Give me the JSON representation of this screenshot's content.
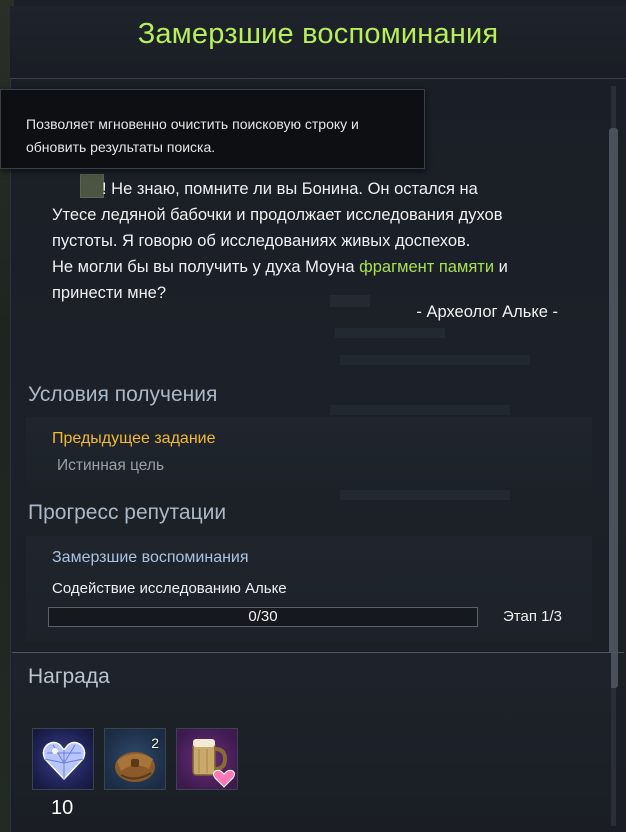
{
  "window": {
    "title": "Замерзшие воспоминания"
  },
  "tooltip": {
    "text": "Позволяет мгновенно очистить поисковую строку и обновить результаты поиска."
  },
  "dialogue": {
    "line1": "! Не знаю, помните ли вы Бонина. Он остался на",
    "line2": "Утесе ледяной бабочки и продолжает исследования духов",
    "line3": "пустоты. Я говорю об исследованиях живых доспехов.",
    "line4_start": "Не могли бы вы получить у духа Моуна ",
    "line4_highlight": "фрагмент памяти",
    "line4_end": " и",
    "line5": "принести мне?",
    "signature": "- Археолог Альке -"
  },
  "conditions": {
    "title": "Условия получения",
    "prev_label": "Предыдущее задание",
    "prev_value": "Истинная цель"
  },
  "reputation": {
    "title": "Прогресс репутации",
    "name": "Замерзшие воспоминания",
    "subtitle": "Содействие исследованию Альке",
    "progress_text": "0/30",
    "progress_fraction": 0,
    "stage": "Этап 1/3"
  },
  "reward": {
    "title": "Награда",
    "items": [
      {
        "icon": "crystal-heart-icon",
        "count": "10"
      },
      {
        "icon": "leather-pouch-icon",
        "count": "2"
      },
      {
        "icon": "beer-mug-heart-icon",
        "count": ""
      }
    ]
  },
  "colors": {
    "title": "#b7ee5a",
    "highlight": "#a8e052",
    "prev_label": "#f2ba2e",
    "section_title": "#aab8c8",
    "rep_name": "#a9c3e0"
  }
}
